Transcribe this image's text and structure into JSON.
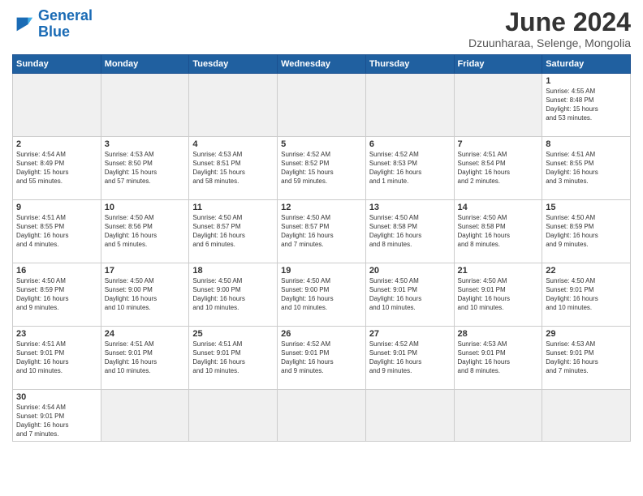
{
  "logo": {
    "general": "General",
    "blue": "Blue"
  },
  "title": "June 2024",
  "subtitle": "Dzuunharaa, Selenge, Mongolia",
  "days_of_week": [
    "Sunday",
    "Monday",
    "Tuesday",
    "Wednesday",
    "Thursday",
    "Friday",
    "Saturday"
  ],
  "weeks": [
    [
      {
        "day": "",
        "info": "",
        "empty": true
      },
      {
        "day": "",
        "info": "",
        "empty": true
      },
      {
        "day": "",
        "info": "",
        "empty": true
      },
      {
        "day": "",
        "info": "",
        "empty": true
      },
      {
        "day": "",
        "info": "",
        "empty": true
      },
      {
        "day": "",
        "info": "",
        "empty": true
      },
      {
        "day": "1",
        "info": "Sunrise: 4:55 AM\nSunset: 8:48 PM\nDaylight: 15 hours\nand 53 minutes."
      }
    ],
    [
      {
        "day": "2",
        "info": "Sunrise: 4:54 AM\nSunset: 8:49 PM\nDaylight: 15 hours\nand 55 minutes."
      },
      {
        "day": "3",
        "info": "Sunrise: 4:53 AM\nSunset: 8:50 PM\nDaylight: 15 hours\nand 57 minutes."
      },
      {
        "day": "4",
        "info": "Sunrise: 4:53 AM\nSunset: 8:51 PM\nDaylight: 15 hours\nand 58 minutes."
      },
      {
        "day": "5",
        "info": "Sunrise: 4:52 AM\nSunset: 8:52 PM\nDaylight: 15 hours\nand 59 minutes."
      },
      {
        "day": "6",
        "info": "Sunrise: 4:52 AM\nSunset: 8:53 PM\nDaylight: 16 hours\nand 1 minute."
      },
      {
        "day": "7",
        "info": "Sunrise: 4:51 AM\nSunset: 8:54 PM\nDaylight: 16 hours\nand 2 minutes."
      },
      {
        "day": "8",
        "info": "Sunrise: 4:51 AM\nSunset: 8:55 PM\nDaylight: 16 hours\nand 3 minutes."
      }
    ],
    [
      {
        "day": "9",
        "info": "Sunrise: 4:51 AM\nSunset: 8:55 PM\nDaylight: 16 hours\nand 4 minutes."
      },
      {
        "day": "10",
        "info": "Sunrise: 4:50 AM\nSunset: 8:56 PM\nDaylight: 16 hours\nand 5 minutes."
      },
      {
        "day": "11",
        "info": "Sunrise: 4:50 AM\nSunset: 8:57 PM\nDaylight: 16 hours\nand 6 minutes."
      },
      {
        "day": "12",
        "info": "Sunrise: 4:50 AM\nSunset: 8:57 PM\nDaylight: 16 hours\nand 7 minutes."
      },
      {
        "day": "13",
        "info": "Sunrise: 4:50 AM\nSunset: 8:58 PM\nDaylight: 16 hours\nand 8 minutes."
      },
      {
        "day": "14",
        "info": "Sunrise: 4:50 AM\nSunset: 8:58 PM\nDaylight: 16 hours\nand 8 minutes."
      },
      {
        "day": "15",
        "info": "Sunrise: 4:50 AM\nSunset: 8:59 PM\nDaylight: 16 hours\nand 9 minutes."
      }
    ],
    [
      {
        "day": "16",
        "info": "Sunrise: 4:50 AM\nSunset: 8:59 PM\nDaylight: 16 hours\nand 9 minutes."
      },
      {
        "day": "17",
        "info": "Sunrise: 4:50 AM\nSunset: 9:00 PM\nDaylight: 16 hours\nand 10 minutes."
      },
      {
        "day": "18",
        "info": "Sunrise: 4:50 AM\nSunset: 9:00 PM\nDaylight: 16 hours\nand 10 minutes."
      },
      {
        "day": "19",
        "info": "Sunrise: 4:50 AM\nSunset: 9:00 PM\nDaylight: 16 hours\nand 10 minutes."
      },
      {
        "day": "20",
        "info": "Sunrise: 4:50 AM\nSunset: 9:01 PM\nDaylight: 16 hours\nand 10 minutes."
      },
      {
        "day": "21",
        "info": "Sunrise: 4:50 AM\nSunset: 9:01 PM\nDaylight: 16 hours\nand 10 minutes."
      },
      {
        "day": "22",
        "info": "Sunrise: 4:50 AM\nSunset: 9:01 PM\nDaylight: 16 hours\nand 10 minutes."
      }
    ],
    [
      {
        "day": "23",
        "info": "Sunrise: 4:51 AM\nSunset: 9:01 PM\nDaylight: 16 hours\nand 10 minutes."
      },
      {
        "day": "24",
        "info": "Sunrise: 4:51 AM\nSunset: 9:01 PM\nDaylight: 16 hours\nand 10 minutes."
      },
      {
        "day": "25",
        "info": "Sunrise: 4:51 AM\nSunset: 9:01 PM\nDaylight: 16 hours\nand 10 minutes."
      },
      {
        "day": "26",
        "info": "Sunrise: 4:52 AM\nSunset: 9:01 PM\nDaylight: 16 hours\nand 9 minutes."
      },
      {
        "day": "27",
        "info": "Sunrise: 4:52 AM\nSunset: 9:01 PM\nDaylight: 16 hours\nand 9 minutes."
      },
      {
        "day": "28",
        "info": "Sunrise: 4:53 AM\nSunset: 9:01 PM\nDaylight: 16 hours\nand 8 minutes."
      },
      {
        "day": "29",
        "info": "Sunrise: 4:53 AM\nSunset: 9:01 PM\nDaylight: 16 hours\nand 7 minutes."
      }
    ],
    [
      {
        "day": "30",
        "info": "Sunrise: 4:54 AM\nSunset: 9:01 PM\nDaylight: 16 hours\nand 7 minutes."
      },
      {
        "day": "",
        "info": "",
        "empty": true
      },
      {
        "day": "",
        "info": "",
        "empty": true
      },
      {
        "day": "",
        "info": "",
        "empty": true
      },
      {
        "day": "",
        "info": "",
        "empty": true
      },
      {
        "day": "",
        "info": "",
        "empty": true
      },
      {
        "day": "",
        "info": "",
        "empty": true
      }
    ]
  ]
}
